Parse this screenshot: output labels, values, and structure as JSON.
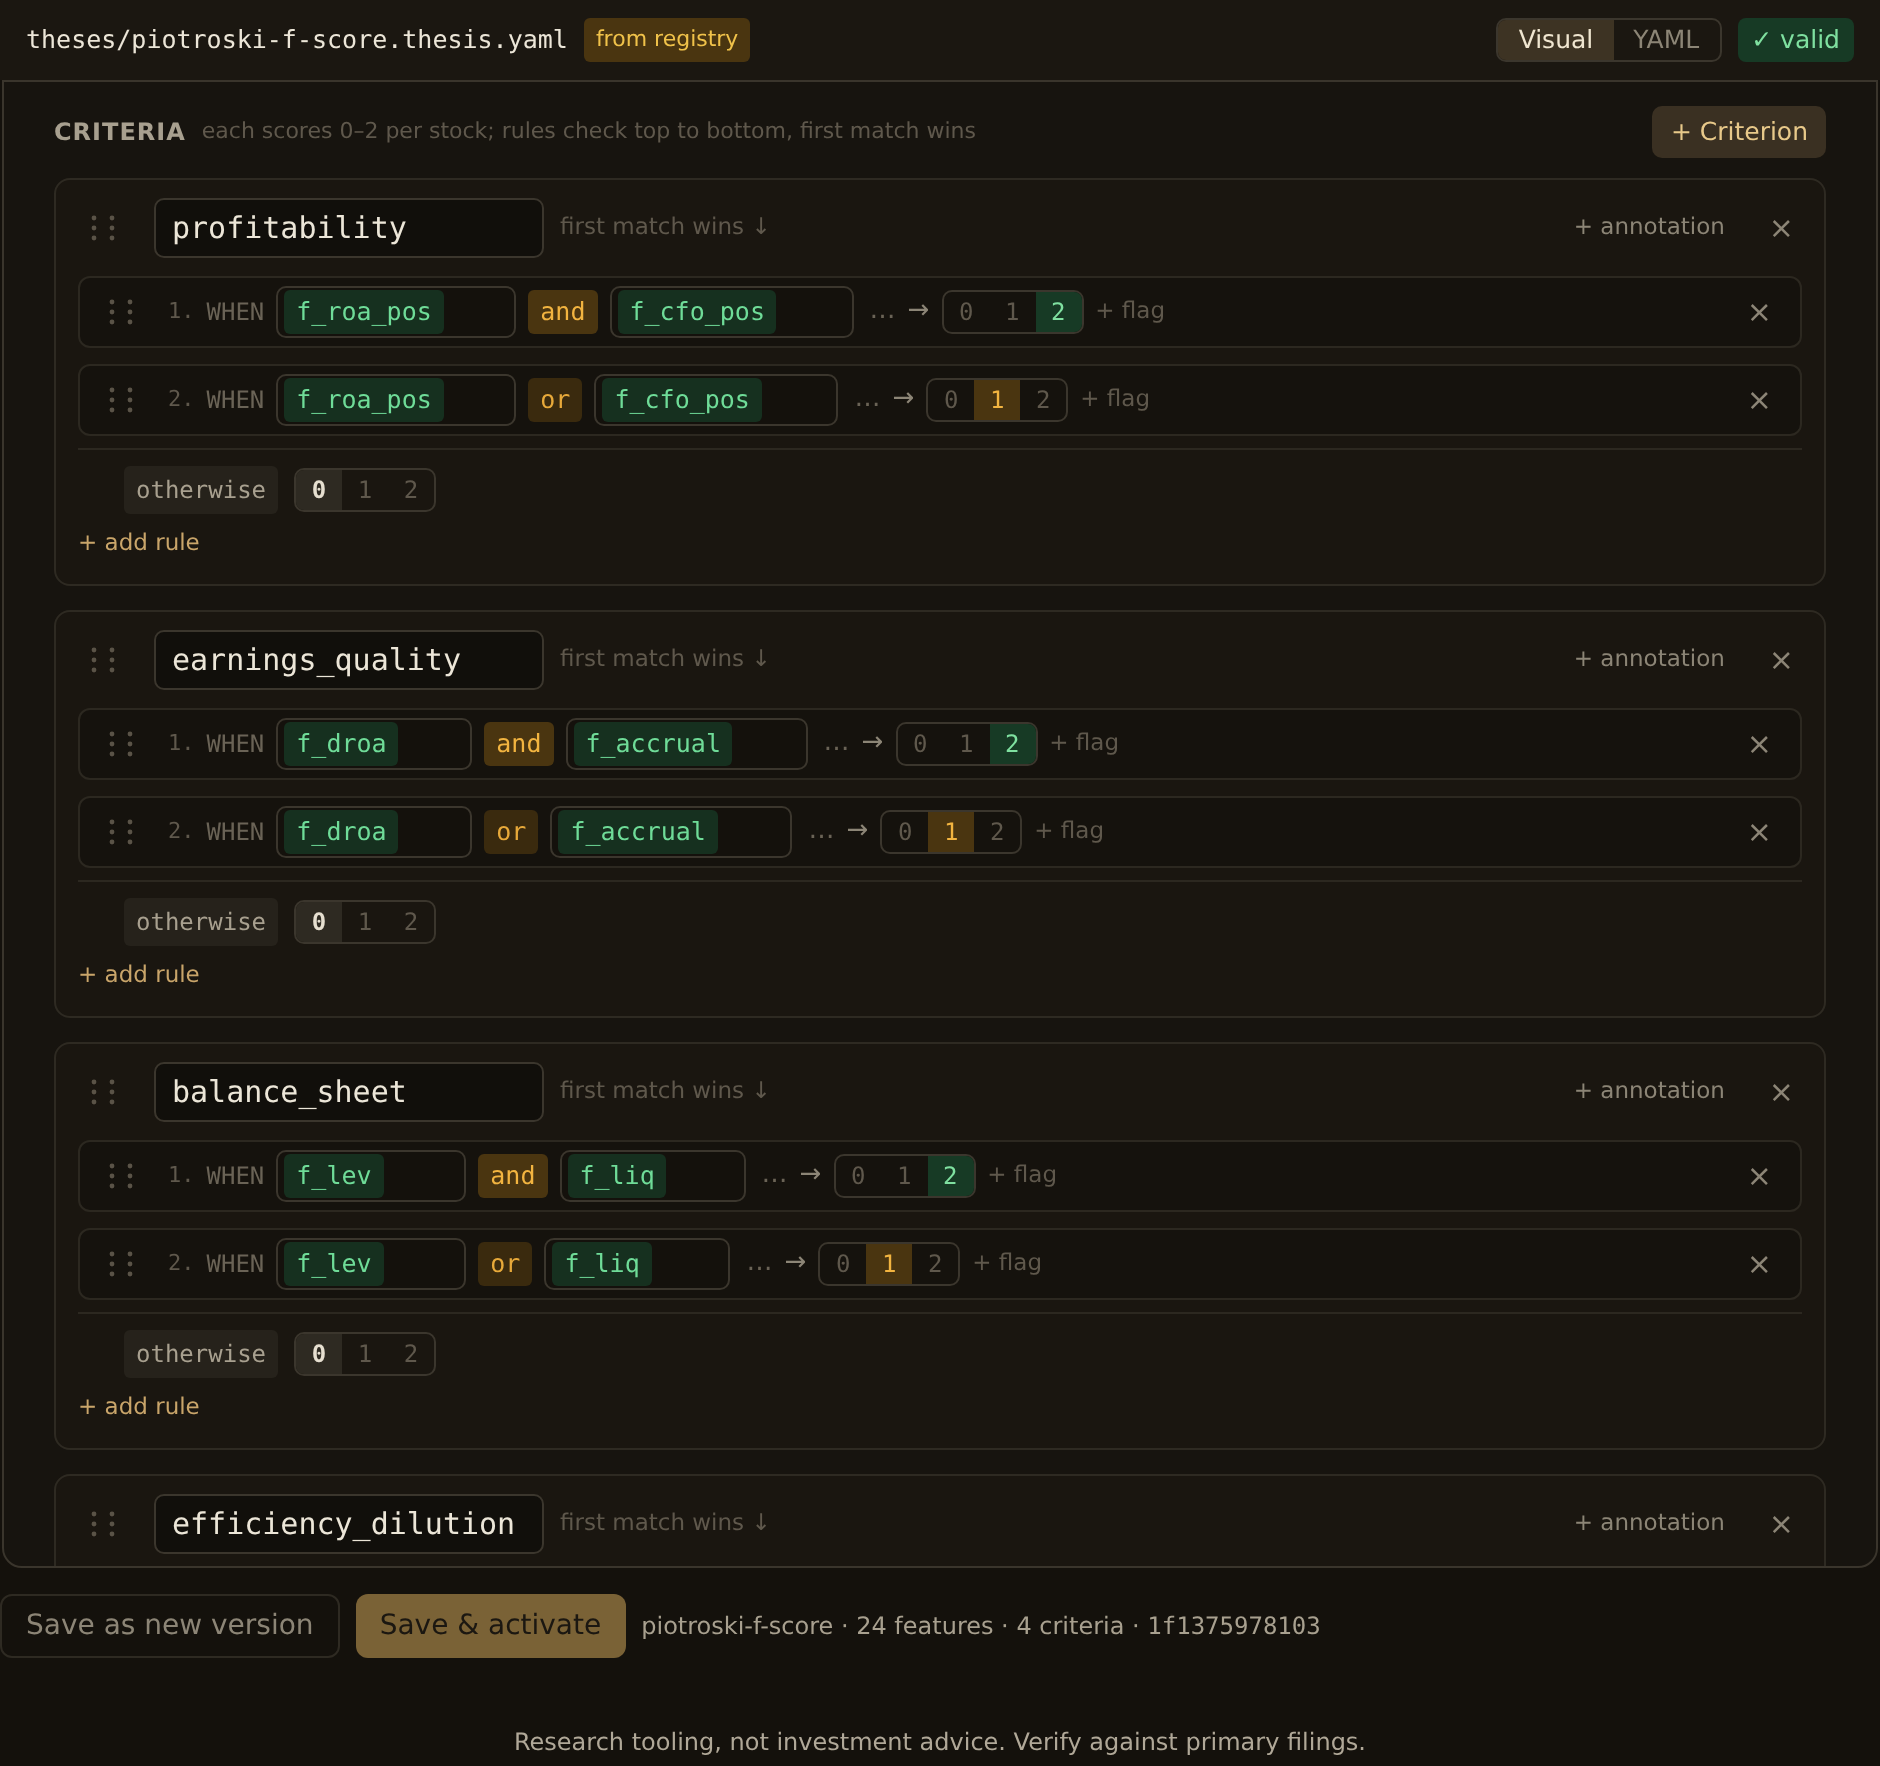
{
  "file": {
    "path": "theses/piotroski-f-score.thesis.yaml",
    "badge": "from registry"
  },
  "view_tabs": [
    {
      "label": "Visual",
      "selected": true
    },
    {
      "label": "YAML",
      "selected": false
    }
  ],
  "status": "✓ valid",
  "criteria": {
    "title": "CRITERIA",
    "hint": "each scores 0–2 per stock; rules check top to bottom, first match wins",
    "add_button": "+ Criterion",
    "items": [
      {
        "name": "profitability",
        "mode": "first match wins ↓",
        "annotation": "+ annotation",
        "close": "×",
        "rules": [
          {
            "number": "1.",
            "when": "WHEN",
            "left": "f_roa_pos",
            "op": "and",
            "right": "f_cfo_pos",
            "more": "…",
            "arrow": "→",
            "scores": [
              {
                "label": "0",
                "selected": false
              },
              {
                "label": "1",
                "selected": false
              },
              {
                "label": "2",
                "selected": true
              }
            ],
            "flag": "+ flag",
            "close": "×"
          },
          {
            "number": "2.",
            "when": "WHEN",
            "left": "f_roa_pos",
            "op": "or",
            "right": "f_cfo_pos",
            "more": "…",
            "arrow": "→",
            "scores": [
              {
                "label": "0",
                "selected": false
              },
              {
                "label": "1",
                "selected": true
              },
              {
                "label": "2",
                "selected": false
              }
            ],
            "flag": "+ flag",
            "close": "×"
          }
        ],
        "otherwise": {
          "label": "otherwise",
          "scores": [
            {
              "label": "0",
              "selected": true
            },
            {
              "label": "1",
              "selected": false
            },
            {
              "label": "2",
              "selected": false
            }
          ]
        },
        "add_rule": "+ add rule"
      },
      {
        "name": "earnings_quality",
        "mode": "first match wins ↓",
        "annotation": "+ annotation",
        "close": "×",
        "rules": [
          {
            "number": "1.",
            "when": "WHEN",
            "left": "f_droa",
            "op": "and",
            "right": "f_accrual",
            "more": "…",
            "arrow": "→",
            "scores": [
              {
                "label": "0",
                "selected": false
              },
              {
                "label": "1",
                "selected": false
              },
              {
                "label": "2",
                "selected": true
              }
            ],
            "flag": "+ flag",
            "close": "×"
          },
          {
            "number": "2.",
            "when": "WHEN",
            "left": "f_droa",
            "op": "or",
            "right": "f_accrual",
            "more": "…",
            "arrow": "→",
            "scores": [
              {
                "label": "0",
                "selected": false
              },
              {
                "label": "1",
                "selected": true
              },
              {
                "label": "2",
                "selected": false
              }
            ],
            "flag": "+ flag",
            "close": "×"
          }
        ],
        "otherwise": {
          "label": "otherwise",
          "scores": [
            {
              "label": "0",
              "selected": true
            },
            {
              "label": "1",
              "selected": false
            },
            {
              "label": "2",
              "selected": false
            }
          ]
        },
        "add_rule": "+ add rule"
      },
      {
        "name": "balance_sheet",
        "mode": "first match wins ↓",
        "annotation": "+ annotation",
        "close": "×",
        "rules": [
          {
            "number": "1.",
            "when": "WHEN",
            "left": "f_lev",
            "op": "and",
            "right": "f_liq",
            "more": "…",
            "arrow": "→",
            "scores": [
              {
                "label": "0",
                "selected": false
              },
              {
                "label": "1",
                "selected": false
              },
              {
                "label": "2",
                "selected": true
              }
            ],
            "flag": "+ flag",
            "close": "×"
          },
          {
            "number": "2.",
            "when": "WHEN",
            "left": "f_lev",
            "op": "or",
            "right": "f_liq",
            "more": "…",
            "arrow": "→",
            "scores": [
              {
                "label": "0",
                "selected": false
              },
              {
                "label": "1",
                "selected": true
              },
              {
                "label": "2",
                "selected": false
              }
            ],
            "flag": "+ flag",
            "close": "×"
          }
        ],
        "otherwise": {
          "label": "otherwise",
          "scores": [
            {
              "label": "0",
              "selected": true
            },
            {
              "label": "1",
              "selected": false
            },
            {
              "label": "2",
              "selected": false
            }
          ]
        },
        "add_rule": "+ add rule"
      },
      {
        "name": "efficiency_dilution",
        "mode": "first match wins ↓",
        "annotation": "+ annotation",
        "close": "×"
      }
    ]
  },
  "actions": [
    {
      "label": "Save as new version",
      "kind": "secondary"
    },
    {
      "label": "Save & activate",
      "kind": "primary"
    }
  ],
  "summary": {
    "text": "piotroski-f-score · 24 features · 4 criteria · ",
    "hash": "1f1375978103"
  },
  "footer": "Research tooling, not investment advice. Verify against primary filings."
}
